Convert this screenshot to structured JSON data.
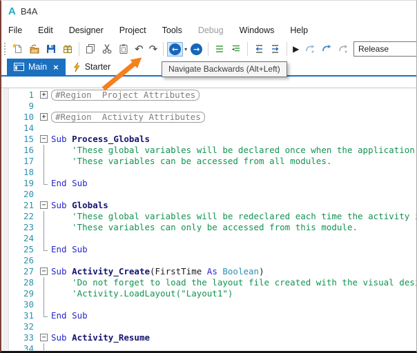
{
  "window": {
    "logo": "A",
    "title": "B4A"
  },
  "menu": {
    "items": [
      {
        "label": "File",
        "enabled": true
      },
      {
        "label": "Edit",
        "enabled": true
      },
      {
        "label": "Designer",
        "enabled": true
      },
      {
        "label": "Project",
        "enabled": true
      },
      {
        "label": "Tools",
        "enabled": true
      },
      {
        "label": "Debug",
        "enabled": false
      },
      {
        "label": "Windows",
        "enabled": true
      },
      {
        "label": "Help",
        "enabled": true
      }
    ]
  },
  "toolbar": {
    "tooltip": "Navigate Backwards (Alt+Left)",
    "release_label": "Release",
    "glyphs": {
      "undo": "↶",
      "redo": "↷",
      "back": "←",
      "forward": "→",
      "caret": "▾",
      "run": "▶",
      "stop": "■",
      "rebuild": "↺"
    },
    "icon_names": [
      "new-project-icon",
      "open-project-icon",
      "save-icon",
      "modules-icon",
      "copy-icon",
      "cut-icon",
      "paste-icon",
      "undo-icon",
      "redo-icon",
      "navigate-back-icon",
      "back-history-caret-icon",
      "navigate-forward-icon",
      "outdent-icon",
      "indent-icon",
      "shift-left-icon",
      "shift-right-icon",
      "run-icon",
      "resume-icon",
      "step-over-icon",
      "step-into-icon",
      "stop-icon",
      "rebuild-icon"
    ]
  },
  "tabs": [
    {
      "label": "Main",
      "icon": "form",
      "close": "×",
      "active": true
    },
    {
      "label": "Starter",
      "icon": "bolt",
      "close": "",
      "active": false
    }
  ],
  "colors": {
    "accent_blue": "#1C70C0",
    "nav_circle_blue": "#1766B8",
    "keyword": "#2727CE",
    "comment": "#12934F",
    "type": "#2B91AF",
    "line_number": "#2B91AF",
    "region": "#7F7F7F",
    "annotation_arrow": "#F5801E",
    "logo": "#1FA9C9"
  },
  "editor": {
    "lines": [
      {
        "n": 1,
        "fold": "plus",
        "seg": [
          {
            "c": "region",
            "t": "#Region  Project Attributes"
          }
        ]
      },
      {
        "n": 9,
        "fold": "none",
        "seg": []
      },
      {
        "n": 10,
        "fold": "plus",
        "seg": [
          {
            "c": "region",
            "t": "#Region  Activity Attributes"
          }
        ]
      },
      {
        "n": 14,
        "fold": "none",
        "seg": []
      },
      {
        "n": 15,
        "fold": "minus",
        "seg": [
          {
            "c": "kw",
            "t": "Sub "
          },
          {
            "c": "name",
            "t": "Process_Globals"
          }
        ]
      },
      {
        "n": 16,
        "fold": "line",
        "seg": [
          {
            "c": "cmt",
            "t": "    'These global variables will be declared once when the application starts."
          }
        ]
      },
      {
        "n": 17,
        "fold": "line",
        "seg": [
          {
            "c": "cmt",
            "t": "    'These variables can be accessed from all modules."
          }
        ]
      },
      {
        "n": 18,
        "fold": "line",
        "seg": []
      },
      {
        "n": 19,
        "fold": "end",
        "seg": [
          {
            "c": "kw",
            "t": "End Sub"
          }
        ]
      },
      {
        "n": 20,
        "fold": "none",
        "seg": []
      },
      {
        "n": 21,
        "fold": "minus",
        "seg": [
          {
            "c": "kw",
            "t": "Sub "
          },
          {
            "c": "name",
            "t": "Globals"
          }
        ]
      },
      {
        "n": 22,
        "fold": "line",
        "seg": [
          {
            "c": "cmt",
            "t": "    'These global variables will be redeclared each time the activity is created."
          }
        ]
      },
      {
        "n": 23,
        "fold": "line",
        "seg": [
          {
            "c": "cmt",
            "t": "    'These variables can only be accessed from this module."
          }
        ]
      },
      {
        "n": 24,
        "fold": "line",
        "seg": []
      },
      {
        "n": 25,
        "fold": "end",
        "seg": [
          {
            "c": "kw",
            "t": "End Sub"
          }
        ]
      },
      {
        "n": 26,
        "fold": "none",
        "seg": []
      },
      {
        "n": 27,
        "fold": "minus",
        "seg": [
          {
            "c": "kw",
            "t": "Sub "
          },
          {
            "c": "name",
            "t": "Activity_Create"
          },
          {
            "c": "pln",
            "t": "(FirstTime "
          },
          {
            "c": "kw",
            "t": "As "
          },
          {
            "c": "typ",
            "t": "Boolean"
          },
          {
            "c": "pln",
            "t": ")"
          }
        ]
      },
      {
        "n": 28,
        "fold": "line",
        "seg": [
          {
            "c": "cmt",
            "t": "    'Do not forget to load the layout file created with the visual designer."
          }
        ]
      },
      {
        "n": 29,
        "fold": "line",
        "seg": [
          {
            "c": "cmt",
            "t": "    'Activity.LoadLayout(\"Layout1\")"
          }
        ]
      },
      {
        "n": 30,
        "fold": "line",
        "seg": []
      },
      {
        "n": 31,
        "fold": "end",
        "seg": [
          {
            "c": "kw",
            "t": "End Sub"
          }
        ]
      },
      {
        "n": 32,
        "fold": "none",
        "seg": []
      },
      {
        "n": 33,
        "fold": "minus",
        "seg": [
          {
            "c": "kw",
            "t": "Sub "
          },
          {
            "c": "name",
            "t": "Activity_Resume"
          }
        ]
      },
      {
        "n": 34,
        "fold": "line",
        "seg": []
      }
    ]
  }
}
